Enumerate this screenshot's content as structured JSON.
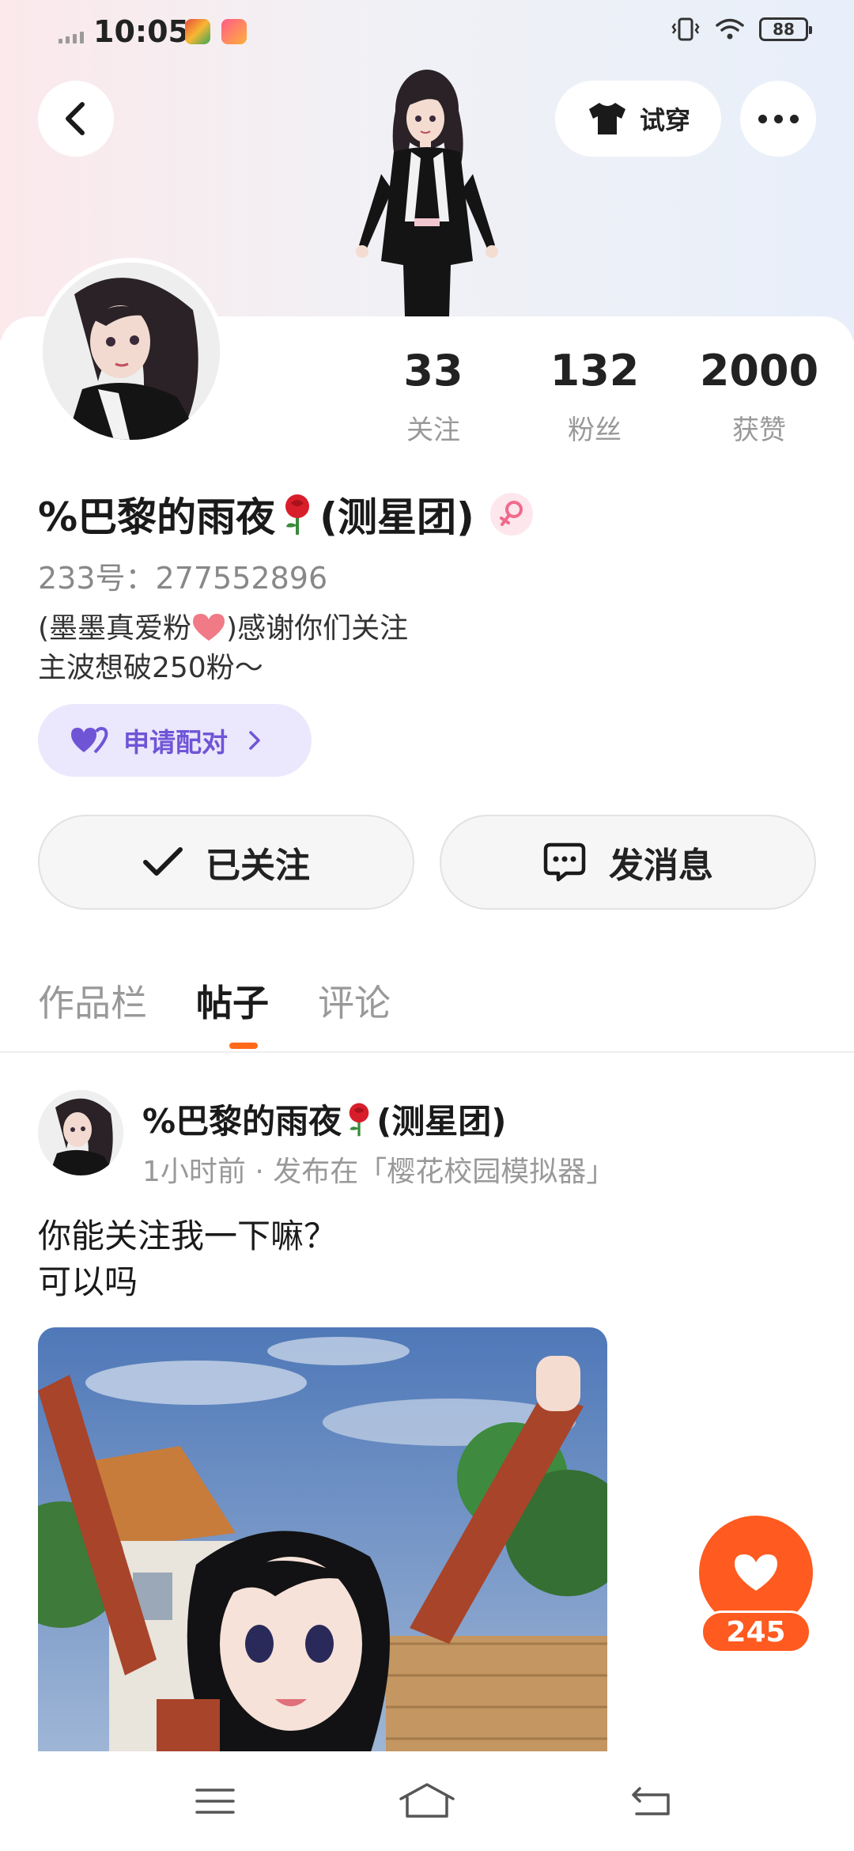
{
  "status_bar": {
    "time": "10:05",
    "battery": "88"
  },
  "header": {
    "try_on_label": "试穿"
  },
  "profile": {
    "stats": [
      {
        "value": "33",
        "label": "关注"
      },
      {
        "value": "132",
        "label": "粉丝"
      },
      {
        "value": "2000",
        "label": "获赞"
      }
    ],
    "name": "%巴黎的雨夜",
    "name_suffix": "(测星团)",
    "uid_label": "233号：",
    "uid": "277552896",
    "bio_line1_a": "(墨墨真爱粉",
    "bio_line1_b": ")感谢你们关注",
    "bio_line2": "主波想破250粉～",
    "pair_label": "申请配对"
  },
  "actions": {
    "followed_label": "已关注",
    "message_label": "发消息"
  },
  "tabs": [
    {
      "label": "作品栏",
      "active": false
    },
    {
      "label": "帖子",
      "active": true
    },
    {
      "label": "评论",
      "active": false
    }
  ],
  "post": {
    "author": "%巴黎的雨夜",
    "author_suffix": "(测星团)",
    "meta": "1小时前 · 发布在「樱花校园模拟器」",
    "text_line1": "你能关注我一下嘛？",
    "text_line2": "可以吗"
  },
  "like": {
    "count": "245"
  },
  "colors": {
    "accent_orange": "#ff5a1f",
    "pair_purple": "#6f55d6",
    "pair_bg": "#ebe7fc"
  }
}
